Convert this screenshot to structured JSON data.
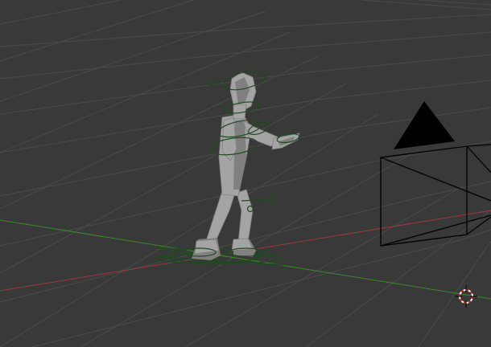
{
  "viewport": {
    "name": "3d-viewport",
    "background_color": "#393939",
    "grid_color": "#4a4a4a",
    "x_axis_color": "#9b3a3a",
    "y_axis_color": "#3c8a2a"
  },
  "character": {
    "name": "rigged-character",
    "body_color": "#a4a4a4",
    "body_shade_color": "#808080",
    "rig_color": "#1f4a1f"
  },
  "camera": {
    "name": "camera-object",
    "line_color": "#000000"
  },
  "cursor": {
    "name": "3d-cursor",
    "ring_color_a": "#cc2222",
    "ring_color_b": "#ffffff",
    "crosshair_color": "#111111"
  }
}
